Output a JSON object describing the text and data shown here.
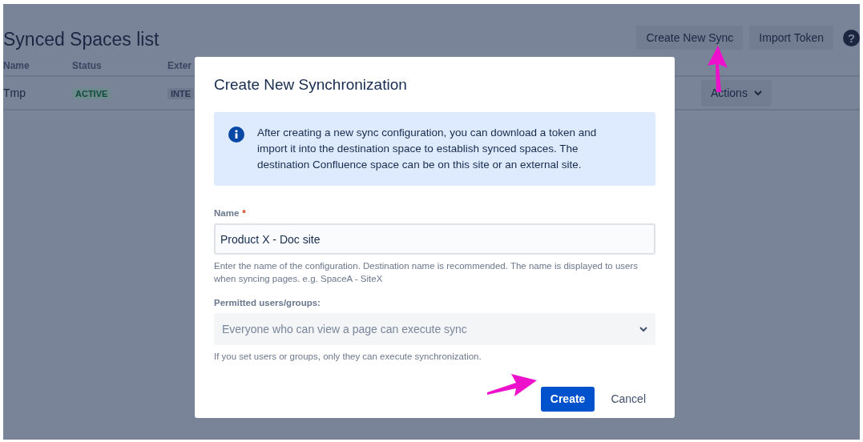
{
  "page": {
    "title": "Synced Spaces list",
    "header_buttons": [
      {
        "label": "Create New Sync"
      },
      {
        "label": "Import Token"
      }
    ],
    "help_button": {
      "label": "?"
    }
  },
  "table": {
    "columns": [
      "Name",
      "Status",
      "Exter"
    ],
    "rows": [
      {
        "name": "Tmp",
        "status": "ACTIVE",
        "column_3": "INTE",
        "actions": "Actions"
      }
    ]
  },
  "dialog": {
    "title": "Create New Synchronization",
    "info": "After creating a new sync configuration, you can download a token and import it into the destination space to establish synced spaces. The destination Confluence space can be on this site or an external site.",
    "fields": [
      {
        "kind": "text",
        "label": "Name",
        "required_mark": "*",
        "value": "Product X - Doc site",
        "help": "Enter the name of the configuration. Destination name is recommended. The name is displayed to users when syncing pages. e.g. SpaceA - SiteX"
      },
      {
        "kind": "select",
        "label": "Permitted users/groups:",
        "placeholder": "Everyone who can view a page can execute sync",
        "help": "If you set users or groups, only they can execute synchronization."
      }
    ],
    "buttons": [
      {
        "label": "Create",
        "kind": "primary"
      },
      {
        "label": "Cancel",
        "kind": "subtle"
      }
    ]
  }
}
